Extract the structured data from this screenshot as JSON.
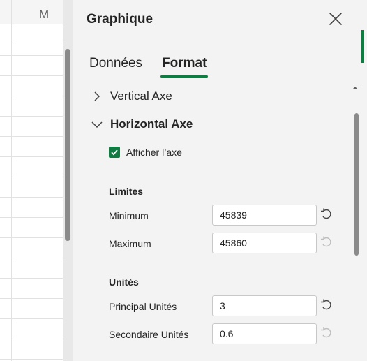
{
  "sheet": {
    "column_letter": "M"
  },
  "pane": {
    "title": "Graphique",
    "tabs": [
      {
        "label": "Données",
        "active": false
      },
      {
        "label": "Format",
        "active": true
      }
    ],
    "sections": [
      {
        "label": "Vertical Axe",
        "expanded": false
      },
      {
        "label": "Horizontal Axe",
        "expanded": true
      }
    ],
    "show_axis": {
      "label": "Afficher l’axe",
      "checked": true
    },
    "limits": {
      "title": "Limites",
      "minimum": {
        "label": "Minimum",
        "value": "45839"
      },
      "maximum": {
        "label": "Maximum",
        "value": "45860"
      }
    },
    "units": {
      "title": "Unités",
      "major": {
        "label": "Principal Unités",
        "value": "3"
      },
      "minor": {
        "label": "Secondaire Unités",
        "value": "0.6"
      }
    }
  },
  "colors": {
    "accent": "#107c41",
    "reset_active": "#424242",
    "reset_disabled": "#bdbdbd"
  }
}
